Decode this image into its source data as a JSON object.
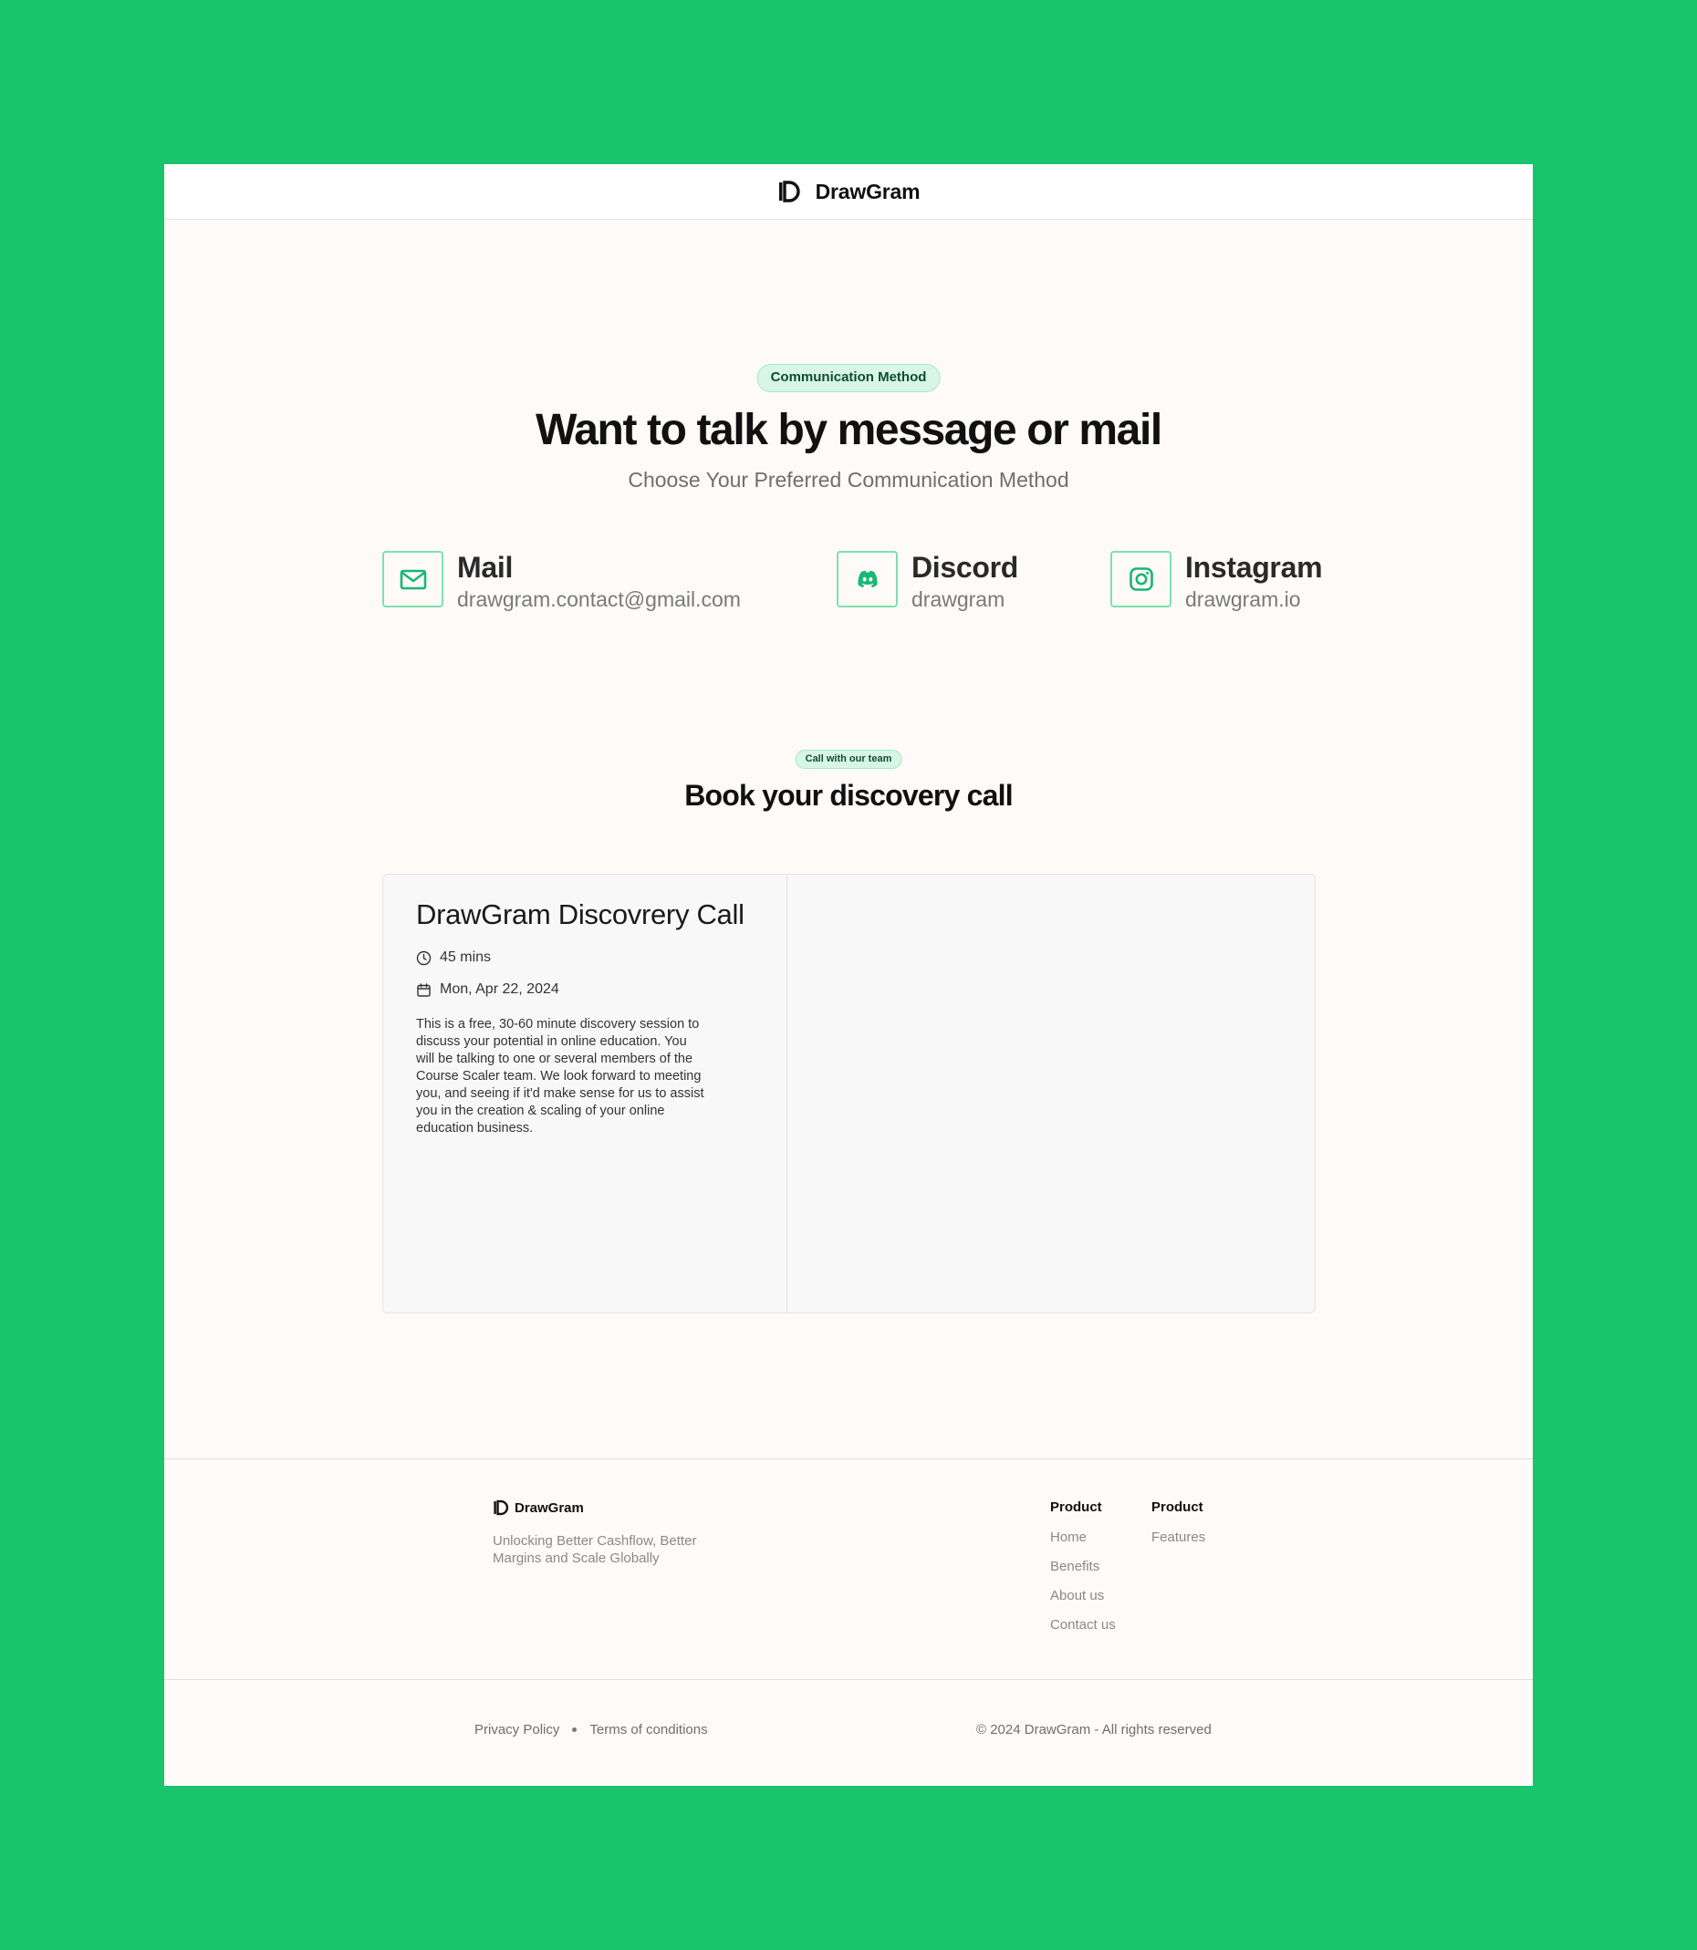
{
  "header": {
    "brand": "DrawGram"
  },
  "contact": {
    "badge": "Communication Method",
    "title": "Want to talk by message or mail",
    "subtitle": "Choose Your Preferred Communication Method",
    "methods": [
      {
        "name": "Mail",
        "value": "drawgram.contact@gmail.com",
        "icon": "mail-icon"
      },
      {
        "name": "Discord",
        "value": "drawgram",
        "icon": "discord-icon"
      },
      {
        "name": "Instagram",
        "value": "drawgram.io",
        "icon": "instagram-icon"
      }
    ]
  },
  "booking": {
    "badge": "Call with our team",
    "title": "Book your discovery call",
    "event_title": "DrawGram Discovrery Call",
    "duration": "45 mins",
    "date": "Mon, Apr 22, 2024",
    "description": "This is a free, 30-60 minute discovery session to discuss your potential in online education. You will be talking to one or several members of the Course Scaler team. We look forward to meeting you, and seeing if it'd make sense for us to assist you in the creation & scaling of your online education business."
  },
  "footer": {
    "brand": "DrawGram",
    "tagline": "Unlocking Better Cashflow, Better Margins and Scale Globally",
    "columns": [
      {
        "heading": "Product",
        "links": [
          "Home",
          "Benefits",
          "About us",
          "Contact us"
        ]
      },
      {
        "heading": "Product",
        "links": [
          "Features"
        ]
      }
    ],
    "legal": {
      "privacy": "Privacy Policy",
      "terms": "Terms of conditions"
    },
    "copyright": "© 2024 DrawGram - All rights reserved"
  },
  "colors": {
    "background": "#19c46c",
    "page": "#fdfaf8",
    "accent": "#19b774",
    "pill_bg": "#d8f5e6"
  }
}
